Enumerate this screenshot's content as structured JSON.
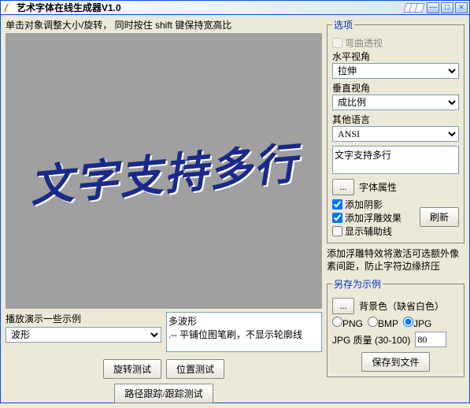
{
  "title": "艺术字体在线生成器V1.0",
  "hint": "单击对象调整大小/旋转，   同时按住 shift 键保持宽高比",
  "canvas_text": "文字支持多行",
  "demo": {
    "label": "播放演示一些示例",
    "select_value": "波形",
    "textarea_value": "多波形\n.-- 平铺位图笔刷，不显示轮廓线"
  },
  "buttons": {
    "rotate_test": "旋转测试",
    "position_test": "位置测试",
    "path_track": "路径跟踪/跟踪测试"
  },
  "options": {
    "legend": "选项",
    "bend_perspective": "弯曲透视",
    "h_view_label": "水平视角",
    "h_view_value": "拉伸",
    "v_view_label": "垂直视角",
    "v_view_value": "成比例",
    "other_lang_label": "其他语言",
    "other_lang_value": "ANSI",
    "text_value": "文字支持多行",
    "font_props": "字体属性",
    "add_shadow": "添加阴影",
    "add_emboss": "添加浮雕效果",
    "show_guides": "显示辅助线",
    "refresh": "刷新"
  },
  "note": "添加浮雕特效将激活可选额外像素间距，防止字符边缘挤压",
  "saveas": {
    "legend": "另存为示例",
    "bgcolor": "背景色（缺省白色）",
    "png": "PNG",
    "bmp": "BMP",
    "jpg": "JPG",
    "quality_label": "JPG 质量 (30-100)",
    "quality_value": "80",
    "save_btn": "保存到文件"
  }
}
